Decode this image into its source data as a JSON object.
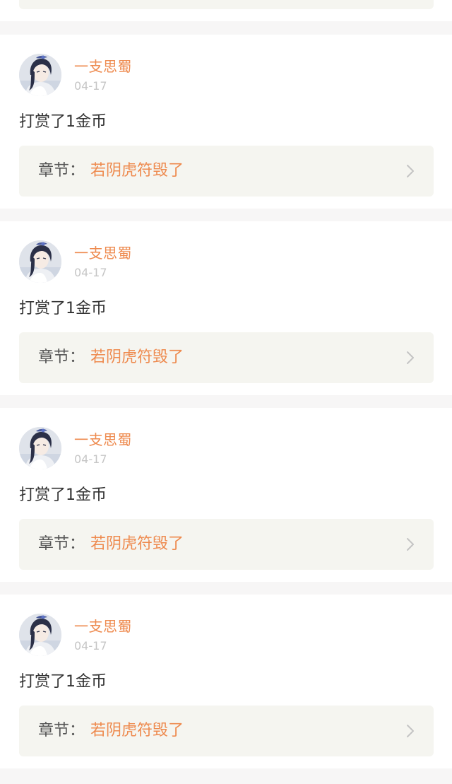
{
  "colors": {
    "accent": "#ee8a4e",
    "page_bg": "#f7f6f6",
    "card_bg": "#ffffff",
    "chapter_bg": "#f5f5f0",
    "text_primary": "#333333",
    "text_muted": "#c6c6c6"
  },
  "feed": {
    "items": [
      {
        "user": {
          "name": "一支思蜀",
          "avatar_icon": "avatar-icon"
        },
        "date": "04-17",
        "action": "打赏了1金币",
        "chapter": {
          "label": "章节：",
          "title": "若阴虎符毁了",
          "arrow_icon": "chevron-right-icon"
        }
      },
      {
        "user": {
          "name": "一支思蜀",
          "avatar_icon": "avatar-icon"
        },
        "date": "04-17",
        "action": "打赏了1金币",
        "chapter": {
          "label": "章节：",
          "title": "若阴虎符毁了",
          "arrow_icon": "chevron-right-icon"
        }
      },
      {
        "user": {
          "name": "一支思蜀",
          "avatar_icon": "avatar-icon"
        },
        "date": "04-17",
        "action": "打赏了1金币",
        "chapter": {
          "label": "章节：",
          "title": "若阴虎符毁了",
          "arrow_icon": "chevron-right-icon"
        }
      },
      {
        "user": {
          "name": "一支思蜀",
          "avatar_icon": "avatar-icon"
        },
        "date": "04-17",
        "action": "打赏了1金币",
        "chapter": {
          "label": "章节：",
          "title": "若阴虎符毁了",
          "arrow_icon": "chevron-right-icon"
        }
      }
    ]
  }
}
